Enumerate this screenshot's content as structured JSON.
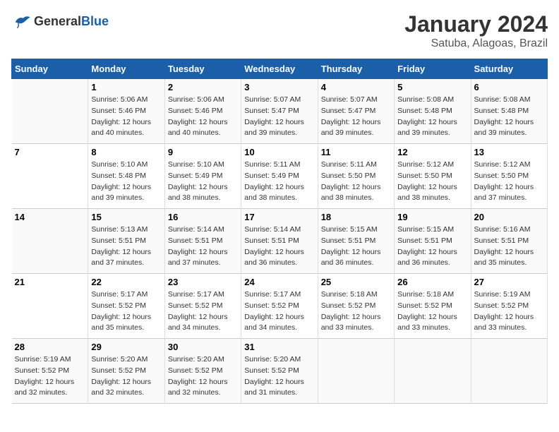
{
  "header": {
    "logo_general": "General",
    "logo_blue": "Blue",
    "title": "January 2024",
    "subtitle": "Satuba, Alagoas, Brazil"
  },
  "calendar": {
    "days_of_week": [
      "Sunday",
      "Monday",
      "Tuesday",
      "Wednesday",
      "Thursday",
      "Friday",
      "Saturday"
    ],
    "weeks": [
      [
        {
          "day": "",
          "info": ""
        },
        {
          "day": "1",
          "info": "Sunrise: 5:06 AM\nSunset: 5:46 PM\nDaylight: 12 hours\nand 40 minutes."
        },
        {
          "day": "2",
          "info": "Sunrise: 5:06 AM\nSunset: 5:46 PM\nDaylight: 12 hours\nand 40 minutes."
        },
        {
          "day": "3",
          "info": "Sunrise: 5:07 AM\nSunset: 5:47 PM\nDaylight: 12 hours\nand 39 minutes."
        },
        {
          "day": "4",
          "info": "Sunrise: 5:07 AM\nSunset: 5:47 PM\nDaylight: 12 hours\nand 39 minutes."
        },
        {
          "day": "5",
          "info": "Sunrise: 5:08 AM\nSunset: 5:48 PM\nDaylight: 12 hours\nand 39 minutes."
        },
        {
          "day": "6",
          "info": "Sunrise: 5:08 AM\nSunset: 5:48 PM\nDaylight: 12 hours\nand 39 minutes."
        }
      ],
      [
        {
          "day": "7",
          "info": ""
        },
        {
          "day": "8",
          "info": "Sunrise: 5:10 AM\nSunset: 5:48 PM\nDaylight: 12 hours\nand 39 minutes."
        },
        {
          "day": "9",
          "info": "Sunrise: 5:10 AM\nSunset: 5:49 PM\nDaylight: 12 hours\nand 38 minutes."
        },
        {
          "day": "10",
          "info": "Sunrise: 5:11 AM\nSunset: 5:49 PM\nDaylight: 12 hours\nand 38 minutes."
        },
        {
          "day": "11",
          "info": "Sunrise: 5:11 AM\nSunset: 5:50 PM\nDaylight: 12 hours\nand 38 minutes."
        },
        {
          "day": "12",
          "info": "Sunrise: 5:12 AM\nSunset: 5:50 PM\nDaylight: 12 hours\nand 38 minutes."
        },
        {
          "day": "13",
          "info": "Sunrise: 5:12 AM\nSunset: 5:50 PM\nDaylight: 12 hours\nand 37 minutes."
        }
      ],
      [
        {
          "day": "14",
          "info": ""
        },
        {
          "day": "15",
          "info": "Sunrise: 5:13 AM\nSunset: 5:51 PM\nDaylight: 12 hours\nand 37 minutes."
        },
        {
          "day": "16",
          "info": "Sunrise: 5:14 AM\nSunset: 5:51 PM\nDaylight: 12 hours\nand 37 minutes."
        },
        {
          "day": "17",
          "info": "Sunrise: 5:14 AM\nSunset: 5:51 PM\nDaylight: 12 hours\nand 36 minutes."
        },
        {
          "day": "18",
          "info": "Sunrise: 5:15 AM\nSunset: 5:51 PM\nDaylight: 12 hours\nand 36 minutes."
        },
        {
          "day": "19",
          "info": "Sunrise: 5:15 AM\nSunset: 5:51 PM\nDaylight: 12 hours\nand 36 minutes."
        },
        {
          "day": "20",
          "info": "Sunrise: 5:16 AM\nSunset: 5:51 PM\nDaylight: 12 hours\nand 35 minutes."
        }
      ],
      [
        {
          "day": "21",
          "info": ""
        },
        {
          "day": "22",
          "info": "Sunrise: 5:17 AM\nSunset: 5:52 PM\nDaylight: 12 hours\nand 35 minutes."
        },
        {
          "day": "23",
          "info": "Sunrise: 5:17 AM\nSunset: 5:52 PM\nDaylight: 12 hours\nand 34 minutes."
        },
        {
          "day": "24",
          "info": "Sunrise: 5:17 AM\nSunset: 5:52 PM\nDaylight: 12 hours\nand 34 minutes."
        },
        {
          "day": "25",
          "info": "Sunrise: 5:18 AM\nSunset: 5:52 PM\nDaylight: 12 hours\nand 33 minutes."
        },
        {
          "day": "26",
          "info": "Sunrise: 5:18 AM\nSunset: 5:52 PM\nDaylight: 12 hours\nand 33 minutes."
        },
        {
          "day": "27",
          "info": "Sunrise: 5:19 AM\nSunset: 5:52 PM\nDaylight: 12 hours\nand 33 minutes."
        }
      ],
      [
        {
          "day": "28",
          "info": "Sunrise: 5:19 AM\nSunset: 5:52 PM\nDaylight: 12 hours\nand 32 minutes."
        },
        {
          "day": "29",
          "info": "Sunrise: 5:20 AM\nSunset: 5:52 PM\nDaylight: 12 hours\nand 32 minutes."
        },
        {
          "day": "30",
          "info": "Sunrise: 5:20 AM\nSunset: 5:52 PM\nDaylight: 12 hours\nand 32 minutes."
        },
        {
          "day": "31",
          "info": "Sunrise: 5:20 AM\nSunset: 5:52 PM\nDaylight: 12 hours\nand 31 minutes."
        },
        {
          "day": "",
          "info": ""
        },
        {
          "day": "",
          "info": ""
        },
        {
          "day": "",
          "info": ""
        }
      ]
    ]
  }
}
